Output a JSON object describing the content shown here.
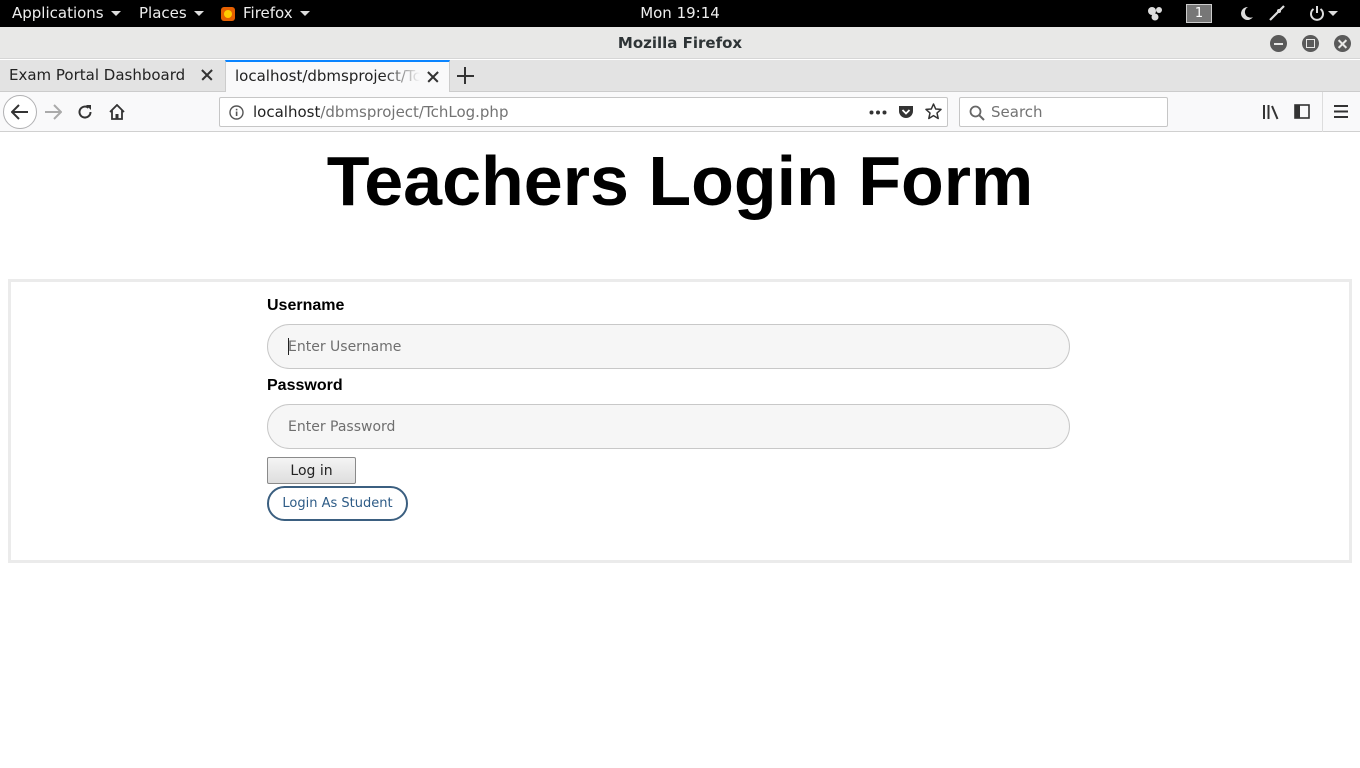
{
  "topbar": {
    "applications": "Applications",
    "places": "Places",
    "firefox": "Firefox",
    "clock": "Mon 19:14",
    "workspace": "1"
  },
  "window": {
    "title": "Mozilla Firefox"
  },
  "tabs": [
    {
      "label": "Exam Portal Dashboard",
      "active": false
    },
    {
      "label": "localhost/dbmsproject/TchLog.php",
      "active": true
    }
  ],
  "navbar": {
    "url_host": "localhost",
    "url_path": "/dbmsproject/TchLog.php",
    "search_placeholder": "Search"
  },
  "page": {
    "heading": "Teachers Login Form",
    "username_label": "Username",
    "username_placeholder": "Enter Username",
    "password_label": "Password",
    "password_placeholder": "Enter Password",
    "login_button": "Log in",
    "student_button": "Login As Student"
  },
  "colors": {
    "active_tab_accent": "#0a84ff",
    "student_button_border": "#3b5f80"
  }
}
